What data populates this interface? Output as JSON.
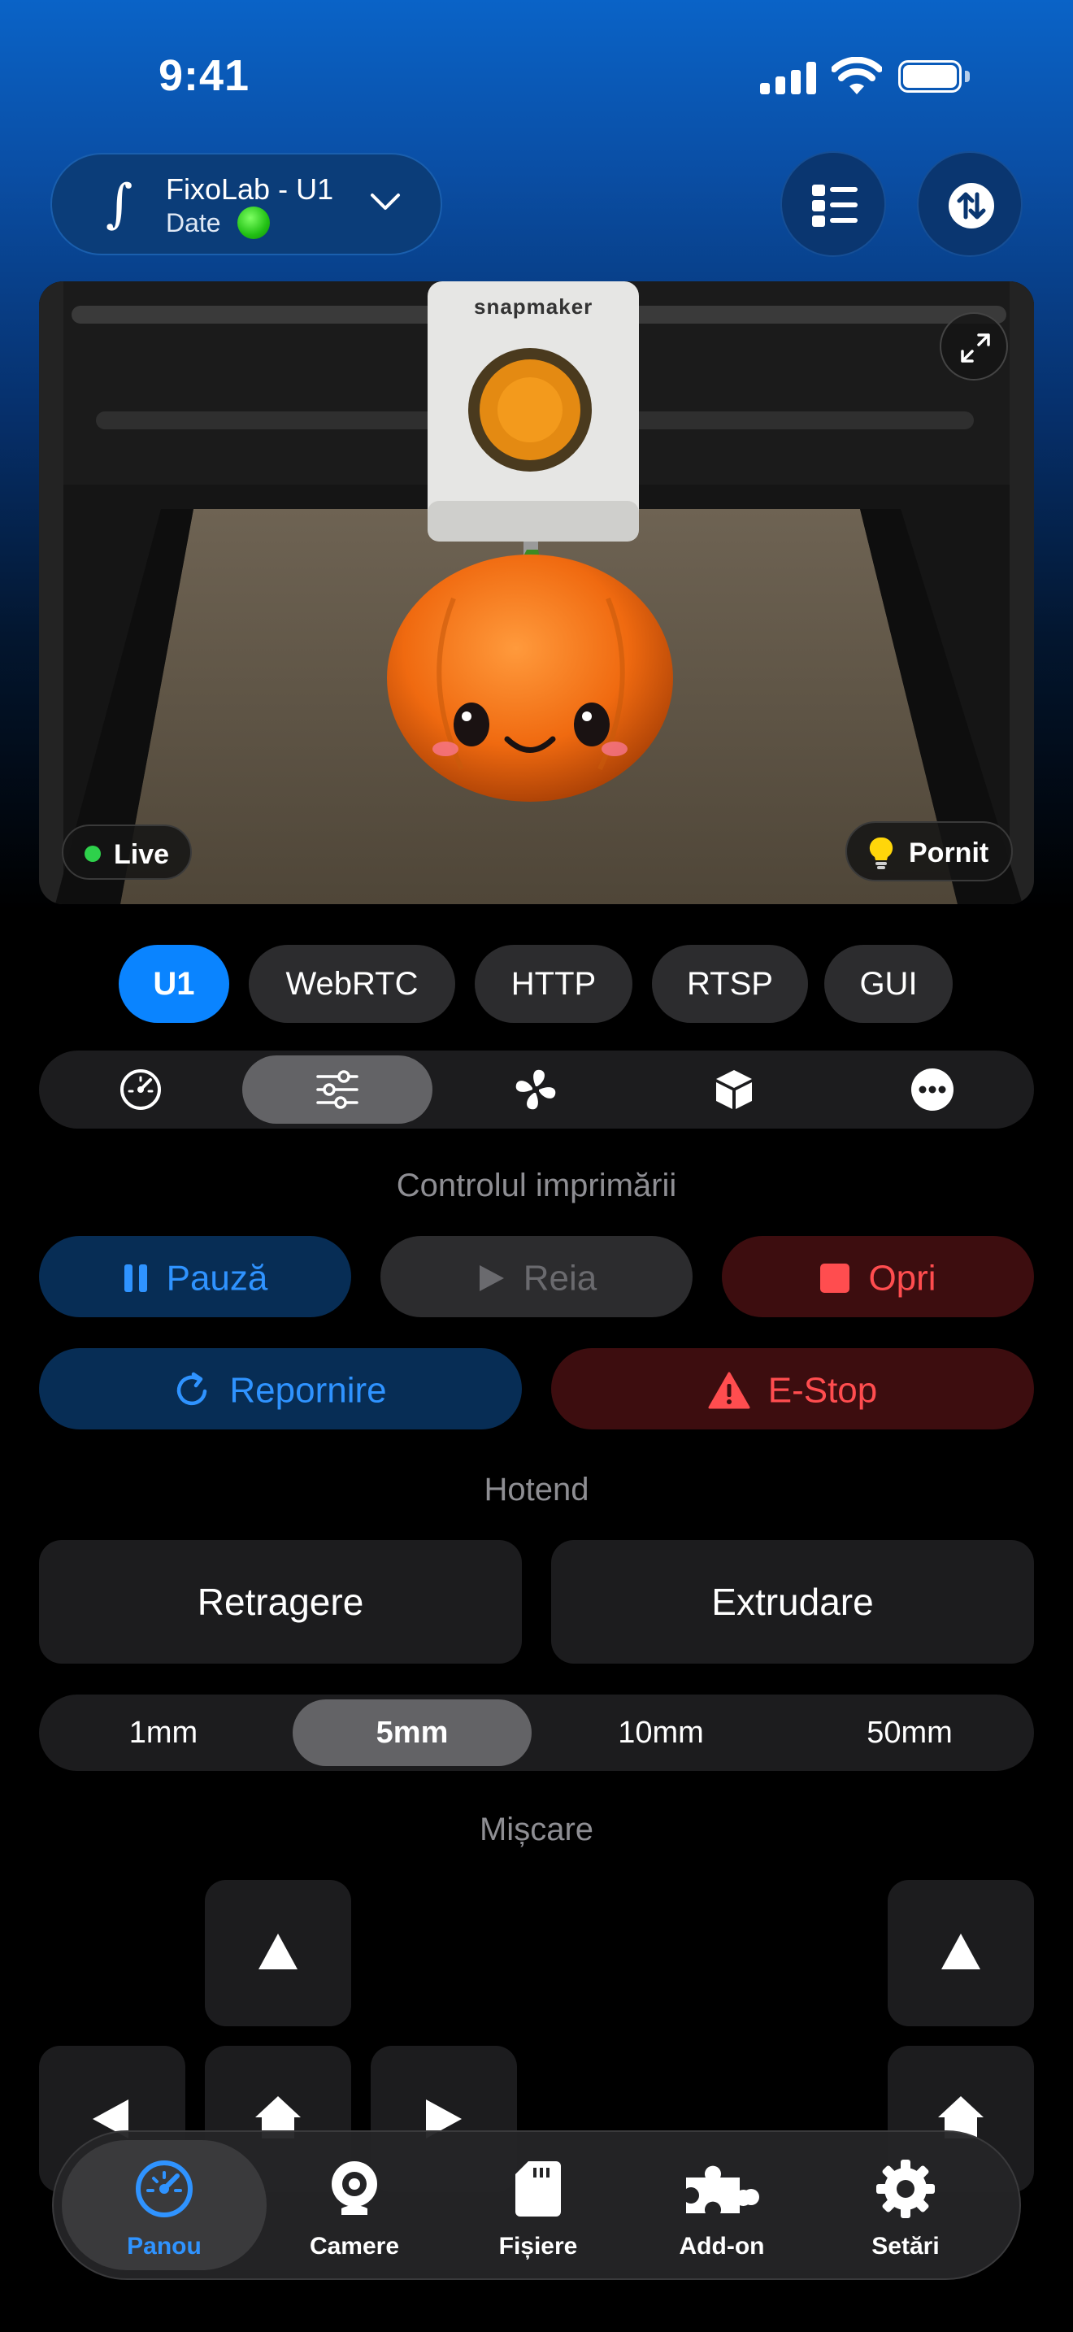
{
  "status_bar": {
    "time": "9:41"
  },
  "header": {
    "printer_name": "FixoLab - U1",
    "printer_sub": "Date",
    "logo_glyph": "∫",
    "list_icon": "list-icon",
    "sync_icon": "sync-arrows-icon"
  },
  "camera": {
    "brand_text": "snapmaker",
    "live_label": "Live",
    "light_label": "Pornit"
  },
  "stream_tabs": [
    {
      "label": "U1",
      "active": true
    },
    {
      "label": "WebRTC",
      "active": false
    },
    {
      "label": "HTTP",
      "active": false
    },
    {
      "label": "RTSP",
      "active": false
    },
    {
      "label": "GUI",
      "active": false
    }
  ],
  "segments": [
    "gauge-icon",
    "sliders-icon",
    "fan-icon",
    "box-icon",
    "more-icon"
  ],
  "print_control": {
    "title": "Controlul imprimării",
    "pause": "Pauză",
    "resume": "Reia",
    "stop": "Opri",
    "restart": "Repornire",
    "estop": "E-Stop"
  },
  "hotend": {
    "title": "Hotend",
    "retract": "Retragere",
    "extrude": "Extrudare",
    "steps": [
      "1mm",
      "5mm",
      "10mm",
      "50mm"
    ],
    "selected_step": "5mm"
  },
  "movement": {
    "title": "Mișcare"
  },
  "tabbar": {
    "items": [
      {
        "label": "Panou",
        "icon": "dashboard-icon",
        "active": true
      },
      {
        "label": "Camere",
        "icon": "webcam-icon",
        "active": false
      },
      {
        "label": "Fișiere",
        "icon": "sd-card-icon",
        "active": false
      },
      {
        "label": "Add-on",
        "icon": "puzzle-icon",
        "active": false
      },
      {
        "label": "Setări",
        "icon": "gear-icon",
        "active": false
      }
    ]
  },
  "colors": {
    "accent": "#0a84ff",
    "danger": "#ff4d4f",
    "surface": "#1c1c1e"
  }
}
